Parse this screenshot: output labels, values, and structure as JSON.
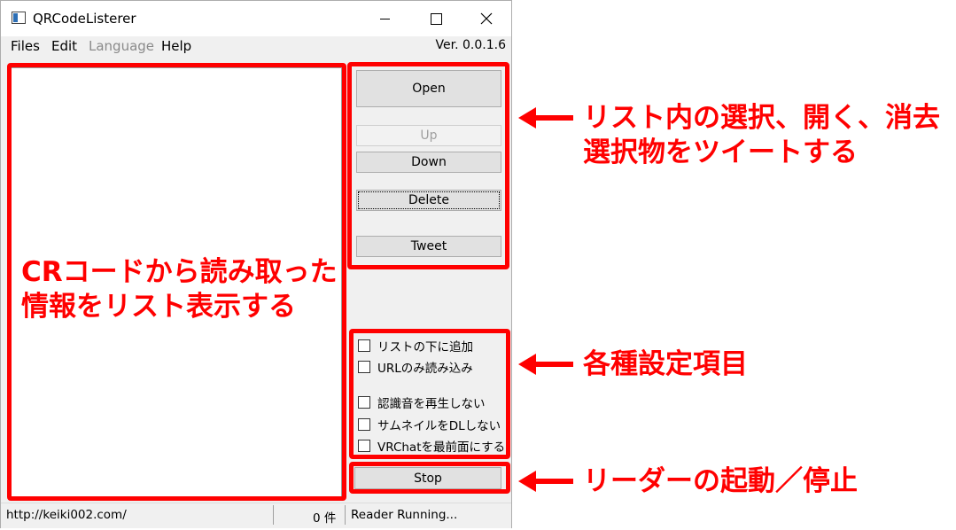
{
  "window": {
    "title": "QRCodeListerer",
    "minimize_glyph": "—",
    "maximize_glyph": "☐",
    "close_glyph": "✕"
  },
  "menu": {
    "files": "Files",
    "edit": "Edit",
    "language": "Language",
    "help": "Help",
    "version": "Ver. 0.0.1.6"
  },
  "buttons": {
    "open": "Open",
    "up": "Up",
    "down": "Down",
    "delete": "Delete",
    "tweet": "Tweet",
    "stop": "Stop"
  },
  "options": [
    "リストの下に追加",
    "URLのみ読み込み",
    "認識音を再生しない",
    "サムネイルをDLしない",
    "VRChatを最前面にする"
  ],
  "status": {
    "url": "http://keiki002.com/",
    "count": "0 件",
    "state": "Reader Running..."
  },
  "annotations": {
    "list": [
      "CRコードから読み取った",
      "情報をリスト表示する"
    ],
    "buttons": [
      "リスト内の選択、開く、消去",
      "選択物をツイートする"
    ],
    "settings": "各種設定項目",
    "reader": "リーダーの起動／停止"
  },
  "colors": {
    "annotation_red": "#ff0000",
    "window_bg": "#f0f0f0",
    "button_bg": "#e1e1e1"
  }
}
